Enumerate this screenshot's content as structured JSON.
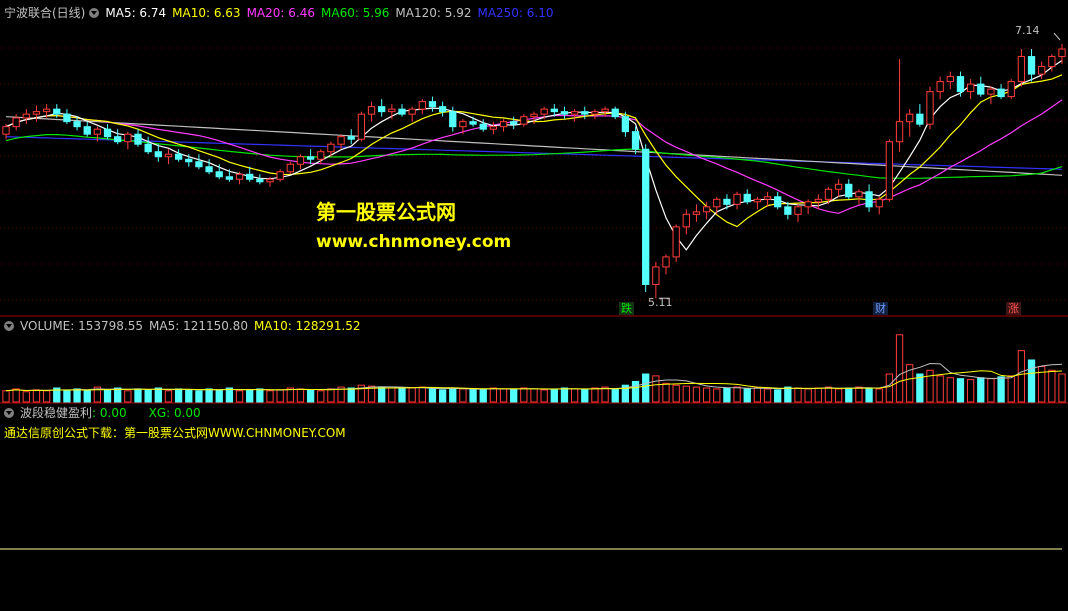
{
  "header_main": {
    "title": "宁波联合(日线)",
    "ma5": "MA5: 6.74",
    "ma10": "MA10: 6.63",
    "ma20": "MA20: 6.46",
    "ma60": "MA60: 5.96",
    "ma120": "MA120: 5.92",
    "ma250": "MA250: 6.10"
  },
  "header_volume": {
    "volume": "VOLUME: 153798.55",
    "ma5": "MA5: 121150.80",
    "ma10": "MA10: 128291.52"
  },
  "header_indicator": {
    "name": "波段稳健盈利",
    "val": ": 0.00",
    "xg": "XG: 0.00",
    "promo": "通达信原创公式下载：第一股票公式网WWW.CHNMONEY.COM"
  },
  "watermark": {
    "line1": "第一股票公式网",
    "line2": "www.chnmoney.com"
  },
  "annotations": {
    "high": "7.14",
    "low": "5.11",
    "tag_die": "跌",
    "tag_cai": "财",
    "tag_zhang": "涨"
  },
  "colors": {
    "up": "#ff3c3c",
    "down": "#54ffff",
    "ma5": "#ffffff",
    "ma10": "#ffff00",
    "ma20": "#ff3cff",
    "ma60": "#00e600",
    "ma120": "#c0c0c0",
    "ma250": "#3232ff",
    "blue_bar": "#1e1eff",
    "green_bar": "#00e600"
  },
  "chart_data": {
    "type": "candlestick",
    "price_ylim": [
      5.0,
      7.3
    ],
    "candles": [
      [
        6.42,
        6.5,
        6.38,
        6.48
      ],
      [
        6.48,
        6.58,
        6.45,
        6.55
      ],
      [
        6.55,
        6.62,
        6.5,
        6.58
      ],
      [
        6.58,
        6.65,
        6.52,
        6.6
      ],
      [
        6.6,
        6.66,
        6.55,
        6.62
      ],
      [
        6.62,
        6.66,
        6.55,
        6.58
      ],
      [
        6.58,
        6.62,
        6.5,
        6.52
      ],
      [
        6.52,
        6.56,
        6.45,
        6.48
      ],
      [
        6.48,
        6.52,
        6.4,
        6.42
      ],
      [
        6.42,
        6.48,
        6.36,
        6.46
      ],
      [
        6.46,
        6.5,
        6.38,
        6.4
      ],
      [
        6.4,
        6.46,
        6.34,
        6.36
      ],
      [
        6.36,
        6.44,
        6.3,
        6.42
      ],
      [
        6.42,
        6.46,
        6.32,
        6.34
      ],
      [
        6.34,
        6.4,
        6.26,
        6.28
      ],
      [
        6.28,
        6.34,
        6.2,
        6.24
      ],
      [
        6.24,
        6.3,
        6.18,
        6.26
      ],
      [
        6.26,
        6.3,
        6.2,
        6.22
      ],
      [
        6.22,
        6.26,
        6.16,
        6.2
      ],
      [
        6.2,
        6.26,
        6.14,
        6.16
      ],
      [
        6.16,
        6.22,
        6.1,
        6.12
      ],
      [
        6.12,
        6.18,
        6.06,
        6.08
      ],
      [
        6.08,
        6.14,
        6.04,
        6.06
      ],
      [
        6.06,
        6.12,
        6.02,
        6.1
      ],
      [
        6.1,
        6.16,
        6.04,
        6.06
      ],
      [
        6.06,
        6.1,
        6.02,
        6.04
      ],
      [
        6.04,
        6.08,
        6.0,
        6.06
      ],
      [
        6.06,
        6.14,
        6.04,
        6.12
      ],
      [
        6.12,
        6.2,
        6.1,
        6.18
      ],
      [
        6.18,
        6.26,
        6.14,
        6.24
      ],
      [
        6.24,
        6.3,
        6.18,
        6.22
      ],
      [
        6.22,
        6.3,
        6.18,
        6.28
      ],
      [
        6.28,
        6.36,
        6.24,
        6.34
      ],
      [
        6.34,
        6.42,
        6.3,
        6.4
      ],
      [
        6.4,
        6.46,
        6.34,
        6.38
      ],
      [
        6.38,
        6.6,
        6.36,
        6.58
      ],
      [
        6.58,
        6.68,
        6.52,
        6.64
      ],
      [
        6.64,
        6.7,
        6.56,
        6.6
      ],
      [
        6.6,
        6.66,
        6.54,
        6.62
      ],
      [
        6.62,
        6.66,
        6.56,
        6.58
      ],
      [
        6.58,
        6.64,
        6.52,
        6.62
      ],
      [
        6.62,
        6.7,
        6.58,
        6.68
      ],
      [
        6.68,
        6.72,
        6.6,
        6.64
      ],
      [
        6.64,
        6.68,
        6.56,
        6.6
      ],
      [
        6.6,
        6.64,
        6.44,
        6.48
      ],
      [
        6.48,
        6.54,
        6.42,
        6.52
      ],
      [
        6.52,
        6.56,
        6.48,
        6.5
      ],
      [
        6.5,
        6.54,
        6.44,
        6.46
      ],
      [
        6.46,
        6.52,
        6.42,
        6.48
      ],
      [
        6.48,
        6.54,
        6.44,
        6.52
      ],
      [
        6.52,
        6.56,
        6.46,
        6.5
      ],
      [
        6.5,
        6.58,
        6.48,
        6.56
      ],
      [
        6.56,
        6.6,
        6.5,
        6.58
      ],
      [
        6.58,
        6.64,
        6.54,
        6.62
      ],
      [
        6.62,
        6.66,
        6.56,
        6.6
      ],
      [
        6.6,
        6.64,
        6.54,
        6.58
      ],
      [
        6.58,
        6.62,
        6.52,
        6.6
      ],
      [
        6.6,
        6.64,
        6.54,
        6.58
      ],
      [
        6.58,
        6.62,
        6.54,
        6.6
      ],
      [
        6.6,
        6.64,
        6.56,
        6.62
      ],
      [
        6.62,
        6.64,
        6.54,
        6.56
      ],
      [
        6.56,
        6.6,
        6.4,
        6.44
      ],
      [
        6.44,
        6.48,
        6.26,
        6.3
      ],
      [
        6.3,
        6.34,
        5.16,
        5.22
      ],
      [
        5.22,
        5.4,
        5.11,
        5.36
      ],
      [
        5.36,
        5.46,
        5.3,
        5.44
      ],
      [
        5.44,
        5.7,
        5.4,
        5.68
      ],
      [
        5.68,
        5.82,
        5.62,
        5.78
      ],
      [
        5.78,
        5.86,
        5.72,
        5.8
      ],
      [
        5.8,
        5.88,
        5.74,
        5.84
      ],
      [
        5.84,
        5.92,
        5.78,
        5.9
      ],
      [
        5.9,
        5.94,
        5.82,
        5.86
      ],
      [
        5.86,
        5.96,
        5.82,
        5.94
      ],
      [
        5.94,
        5.98,
        5.86,
        5.88
      ],
      [
        5.88,
        5.92,
        5.82,
        5.9
      ],
      [
        5.9,
        5.96,
        5.84,
        5.92
      ],
      [
        5.92,
        5.96,
        5.82,
        5.84
      ],
      [
        5.84,
        5.88,
        5.74,
        5.78
      ],
      [
        5.78,
        5.86,
        5.72,
        5.84
      ],
      [
        5.84,
        5.9,
        5.78,
        5.88
      ],
      [
        5.88,
        5.94,
        5.82,
        5.9
      ],
      [
        5.9,
        6.0,
        5.86,
        5.98
      ],
      [
        5.98,
        6.06,
        5.92,
        6.02
      ],
      [
        6.02,
        6.06,
        5.9,
        5.92
      ],
      [
        5.92,
        5.98,
        5.86,
        5.96
      ],
      [
        5.96,
        6.02,
        5.8,
        5.84
      ],
      [
        5.84,
        5.92,
        5.78,
        5.9
      ],
      [
        5.9,
        6.38,
        5.88,
        6.36
      ],
      [
        6.36,
        7.02,
        6.28,
        6.52
      ],
      [
        6.52,
        6.62,
        6.4,
        6.58
      ],
      [
        6.58,
        6.66,
        6.48,
        6.5
      ],
      [
        6.5,
        6.8,
        6.46,
        6.76
      ],
      [
        6.76,
        6.88,
        6.7,
        6.84
      ],
      [
        6.84,
        6.92,
        6.78,
        6.88
      ],
      [
        6.88,
        6.92,
        6.72,
        6.76
      ],
      [
        6.76,
        6.86,
        6.7,
        6.82
      ],
      [
        6.82,
        6.88,
        6.72,
        6.74
      ],
      [
        6.74,
        6.8,
        6.66,
        6.78
      ],
      [
        6.78,
        6.82,
        6.7,
        6.72
      ],
      [
        6.72,
        6.86,
        6.7,
        6.84
      ],
      [
        6.84,
        7.1,
        6.8,
        7.04
      ],
      [
        7.04,
        7.1,
        6.84,
        6.9
      ],
      [
        6.9,
        7.0,
        6.86,
        6.96
      ],
      [
        6.96,
        7.06,
        6.92,
        7.04
      ],
      [
        7.04,
        7.14,
        6.98,
        7.1
      ]
    ],
    "volume": [
      12,
      14,
      11,
      13,
      12,
      15,
      13,
      14,
      12,
      16,
      13,
      15,
      12,
      14,
      13,
      15,
      12,
      14,
      13,
      12,
      14,
      13,
      15,
      12,
      13,
      14,
      12,
      13,
      15,
      14,
      13,
      12,
      14,
      16,
      15,
      18,
      17,
      16,
      15,
      14,
      15,
      16,
      14,
      13,
      15,
      14,
      13,
      14,
      15,
      14,
      13,
      15,
      14,
      13,
      14,
      15,
      14,
      13,
      15,
      16,
      14,
      18,
      22,
      30,
      28,
      20,
      18,
      17,
      16,
      15,
      14,
      15,
      16,
      14,
      15,
      14,
      13,
      16,
      15,
      14,
      15,
      16,
      14,
      15,
      16,
      15,
      14,
      30,
      72,
      40,
      30,
      34,
      28,
      26,
      25,
      24,
      26,
      25,
      27,
      28,
      55,
      45,
      38,
      34,
      30
    ],
    "indicator": {
      "signal_bars": [
        0,
        0,
        0,
        0,
        0,
        0,
        0,
        0,
        0,
        0,
        0,
        0,
        0,
        0,
        0,
        0,
        0,
        0,
        0,
        0,
        0,
        0,
        0,
        0,
        0,
        0,
        0,
        0,
        0,
        0,
        0,
        0,
        0,
        0,
        0,
        0,
        0,
        0,
        0,
        0,
        0,
        0,
        0,
        0,
        0,
        0,
        0,
        0,
        0,
        0,
        0,
        0,
        0,
        0,
        0,
        0,
        0,
        0,
        0,
        0,
        0,
        0,
        0,
        0,
        0,
        0,
        0,
        0,
        0,
        0,
        0,
        0,
        0,
        0,
        0,
        0,
        0,
        0,
        0,
        0,
        0,
        0,
        0,
        0,
        0,
        0,
        0,
        0,
        0,
        0,
        0,
        0,
        0,
        0,
        0,
        0,
        0,
        0,
        0,
        0,
        0,
        0,
        0,
        0,
        0
      ]
    }
  }
}
